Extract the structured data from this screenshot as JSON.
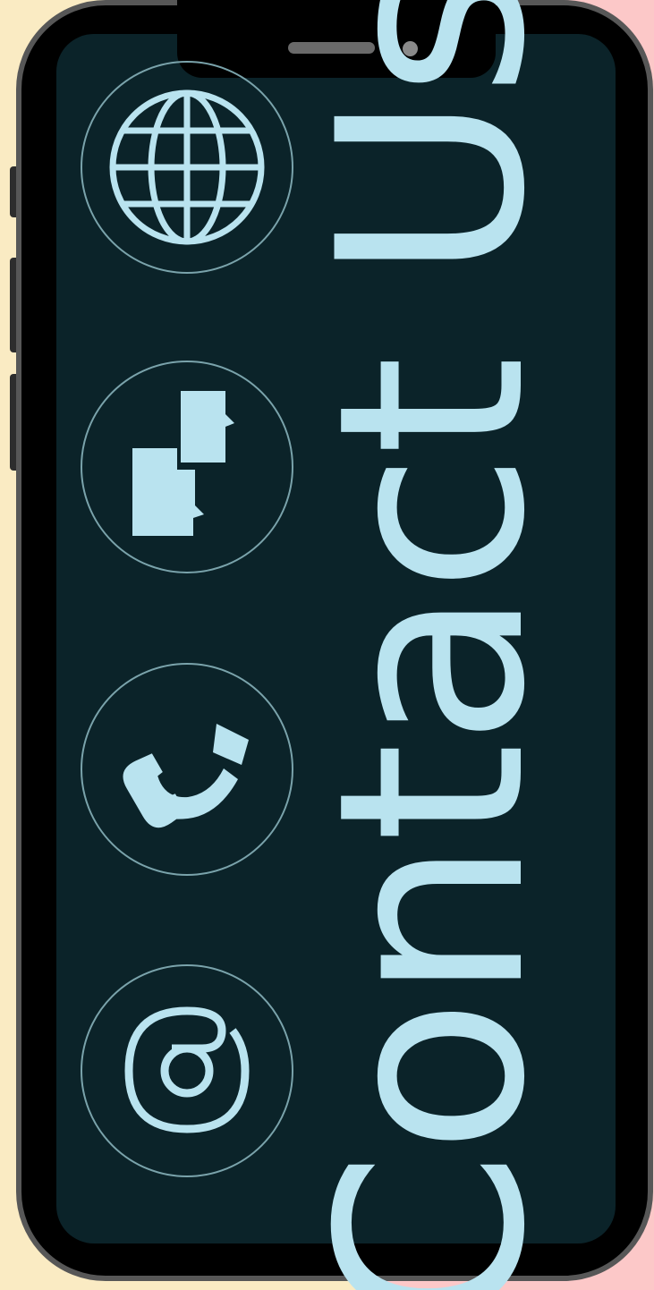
{
  "title": "Contact Us",
  "icons": [
    {
      "name": "globe-icon"
    },
    {
      "name": "chat-icon"
    },
    {
      "name": "phone-icon"
    },
    {
      "name": "email-at-icon"
    }
  ],
  "colors": {
    "background_left": "#faebc3",
    "background_right": "#fcc8c8",
    "phone_body": "#000000",
    "phone_bezel": "#575757",
    "screen": "#0b2329",
    "accent": "#b9e3ef",
    "icon_ring": "#7aa3ab"
  }
}
